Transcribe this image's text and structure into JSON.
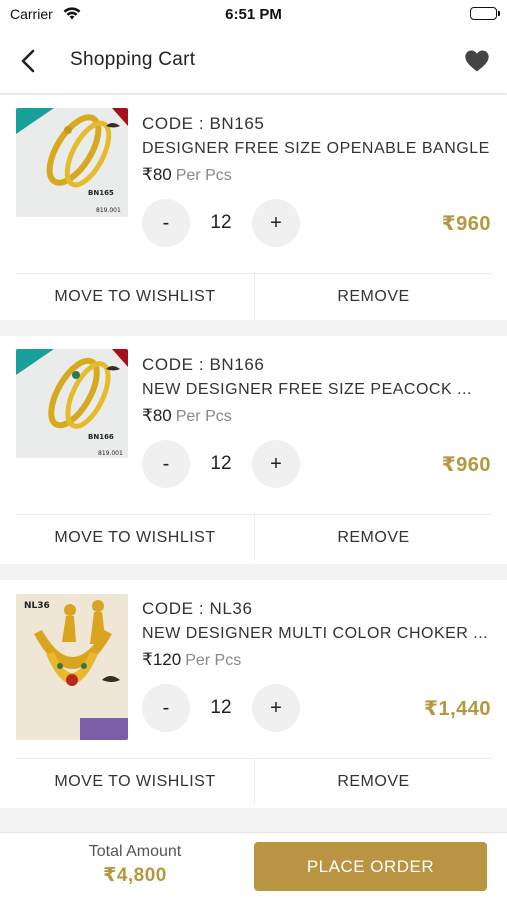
{
  "status_bar": {
    "carrier": "Carrier",
    "time": "6:51 PM"
  },
  "nav": {
    "title": "Shopping Cart"
  },
  "currency": "₹",
  "colors": {
    "accent": "#b5973f",
    "button": "#b89443"
  },
  "items": [
    {
      "code": "CODE : BN165",
      "name": "DESIGNER FREE SIZE OPENABLE BANGLE",
      "price": "₹80",
      "unit": "Per Pcs",
      "qty_minus": "-",
      "qty": "12",
      "qty_plus": "+",
      "total": "₹960",
      "thumb_tag": "BN165",
      "thumb_code": "819.001",
      "wishlist_label": "MOVE TO WISHLIST",
      "remove_label": "REMOVE"
    },
    {
      "code": "CODE : BN166",
      "name": "NEW DESIGNER FREE SIZE PEACOCK ...",
      "price": "₹80",
      "unit": "Per Pcs",
      "qty_minus": "-",
      "qty": "12",
      "qty_plus": "+",
      "total": "₹960",
      "thumb_tag": "BN166",
      "thumb_code": "819.001",
      "wishlist_label": "MOVE TO WISHLIST",
      "remove_label": "REMOVE"
    },
    {
      "code": "CODE : NL36",
      "name": "NEW DESIGNER MULTI COLOR CHOKER ...",
      "price": "₹120",
      "unit": "Per Pcs",
      "qty_minus": "-",
      "qty": "12",
      "qty_plus": "+",
      "total": "₹1,440",
      "thumb_tag": "NL36",
      "thumb_code": "",
      "wishlist_label": "MOVE TO WISHLIST",
      "remove_label": "REMOVE"
    }
  ],
  "footer": {
    "total_label": "Total Amount",
    "total_amount": "₹4,800",
    "place_order_label": "PLACE ORDER"
  }
}
